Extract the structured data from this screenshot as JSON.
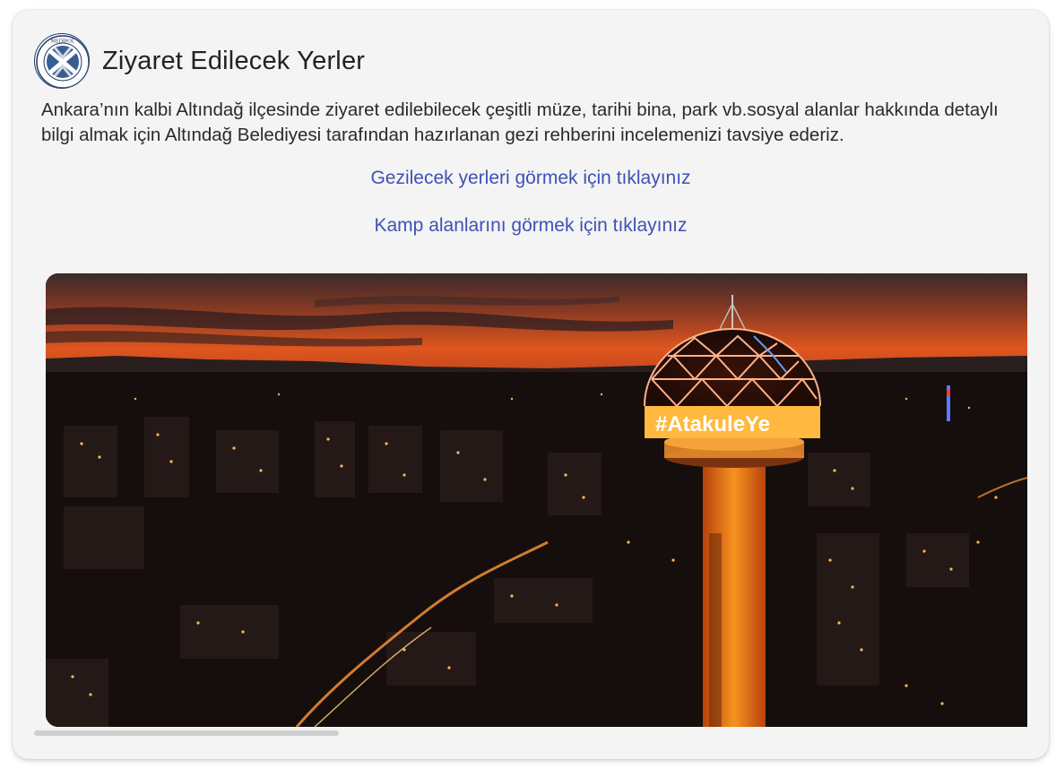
{
  "header": {
    "logo_icon": "medipol-university-seal",
    "logo_text": "MEDİPOL",
    "title": "Ziyaret Edilecek Yerler"
  },
  "description": "Ankara’nın kalbi Altındağ ilçesinde ziyaret edilebilecek çeşitli müze, tarihi bina, park vb.sosyal alanlar hakkında detaylı bilgi almak için Altındağ Belediyesi tarafından hazırlanan gezi rehberini incelemenizi tavsiye ederiz.",
  "links": {
    "places": "Gezilecek yerleri görmek için tıklayınız",
    "camps": "Kamp alanlarını görmek için tıklayınız"
  },
  "photo": {
    "tower_sign": "#AtakuleYe"
  },
  "colors": {
    "link": "#3f51b5",
    "card_bg": "#f4f4f4",
    "sky_orange": "#e0561f",
    "tower_glow": "#f07a1a"
  }
}
